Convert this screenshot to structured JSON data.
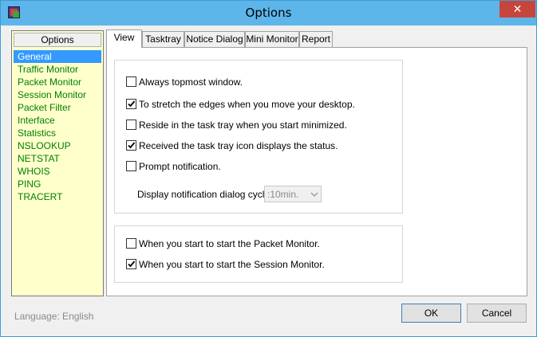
{
  "window": {
    "title": "Options",
    "close_label": "✕"
  },
  "sidebar": {
    "header": "Options",
    "items": [
      {
        "label": "General",
        "selected": true
      },
      {
        "label": "Traffic Monitor"
      },
      {
        "label": "Packet Monitor"
      },
      {
        "label": "Session Monitor"
      },
      {
        "label": "Packet Filter"
      },
      {
        "label": "Interface"
      },
      {
        "label": "Statistics"
      },
      {
        "label": "NSLOOKUP"
      },
      {
        "label": "NETSTAT"
      },
      {
        "label": "WHOIS"
      },
      {
        "label": "PING"
      },
      {
        "label": "TRACERT"
      }
    ]
  },
  "tabs": [
    {
      "label": "View",
      "active": true
    },
    {
      "label": "Tasktray"
    },
    {
      "label": "Notice Dialog"
    },
    {
      "label": "Mini Monitor"
    },
    {
      "label": "Report"
    }
  ],
  "view": {
    "options": [
      {
        "label": "Always topmost window.",
        "checked": false
      },
      {
        "label": "To stretch the edges when you move your desktop.",
        "checked": true
      },
      {
        "label": "Reside in the task tray when you start minimized.",
        "checked": false
      },
      {
        "label": "Received the task tray icon displays the status.",
        "checked": true
      },
      {
        "label": "Prompt notification.",
        "checked": false
      }
    ],
    "cycle_label": "Display notification dialog cycle.",
    "cycle_value": ":10min.",
    "startup": [
      {
        "label": "When you start to start the Packet Monitor.",
        "checked": false
      },
      {
        "label": "When you start to start the Session Monitor.",
        "checked": true
      }
    ]
  },
  "footer": {
    "language": "Language: English",
    "ok": "OK",
    "cancel": "Cancel"
  },
  "colors": {
    "titlebar": "#5eb5e9",
    "sidebar_bg": "#ffffcc",
    "sidebar_text": "#008000",
    "selection": "#3399ff",
    "close": "#c7463c"
  }
}
